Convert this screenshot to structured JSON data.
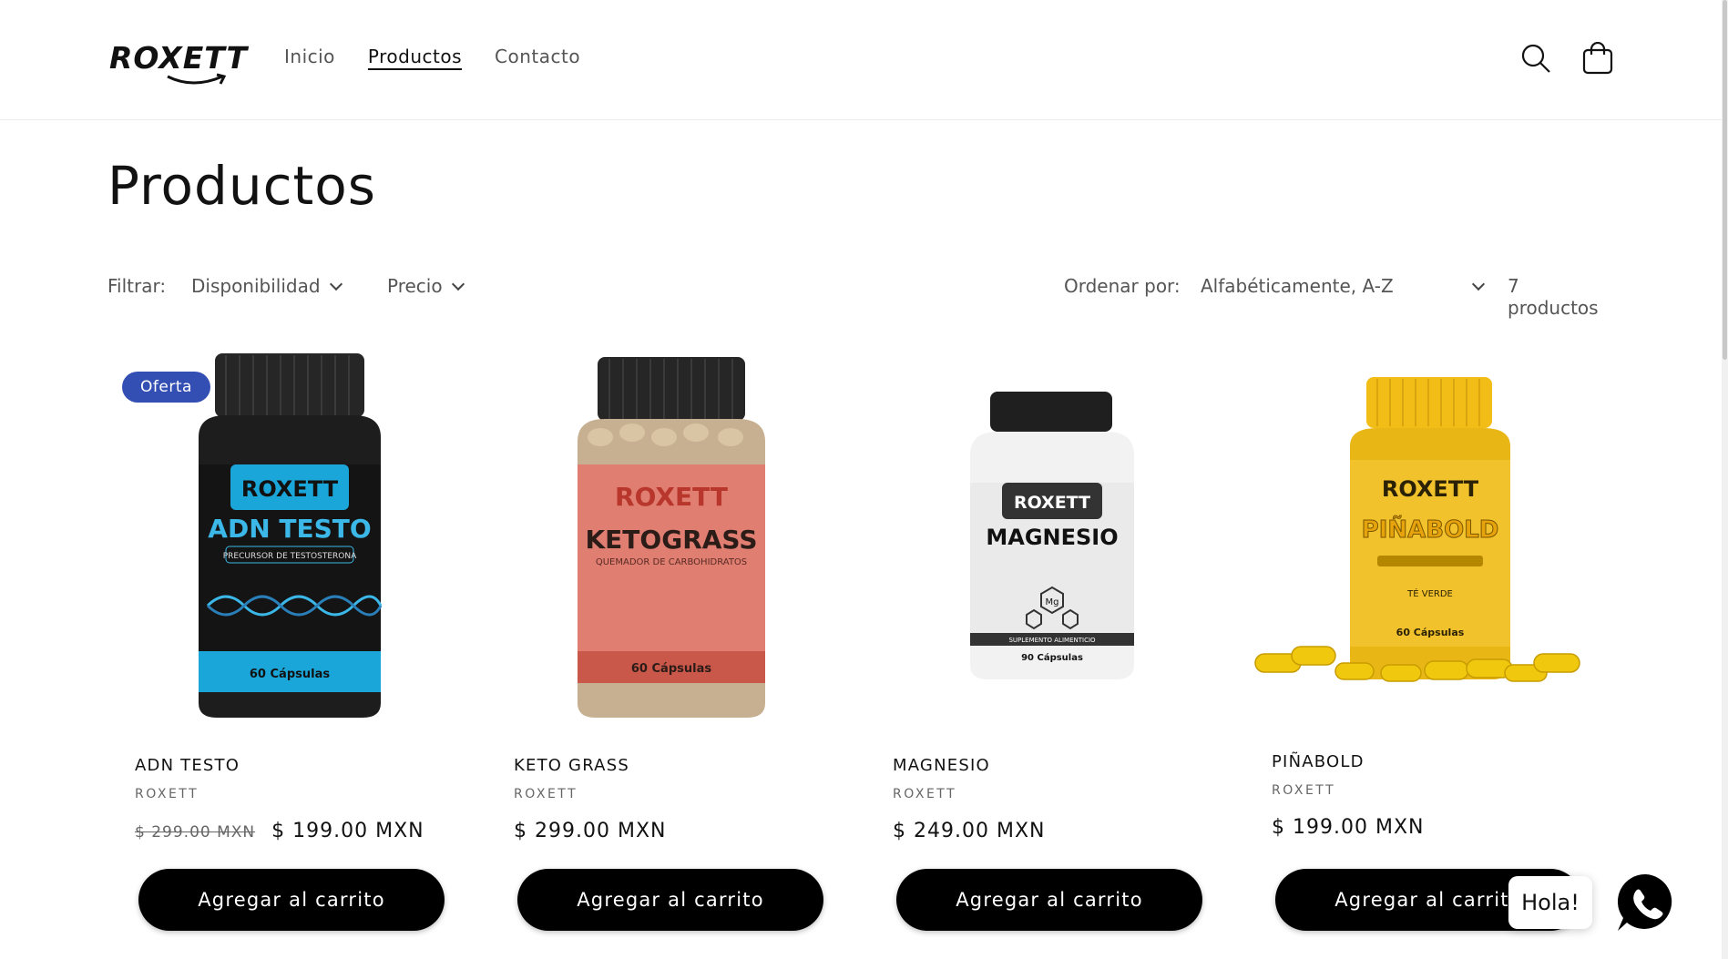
{
  "brand": {
    "logo_text": "ROXETT"
  },
  "nav": {
    "items": [
      "Inicio",
      "Productos",
      "Contacto"
    ],
    "active": "Productos"
  },
  "header": {
    "search_icon": "search-icon",
    "cart_icon": "bag-icon"
  },
  "page": {
    "title": "Productos"
  },
  "filters": {
    "label": "Filtrar:",
    "availability": "Disponibilidad",
    "price": "Precio",
    "sort_label": "Ordenar por:",
    "sort_value": "Alfabéticamente, A-Z",
    "count": "7 productos"
  },
  "products": [
    {
      "title": "ADN TESTO",
      "vendor": "ROXETT",
      "badge": "Oferta",
      "price_old": "$ 299.00 MXN",
      "price": "$ 199.00 MXN",
      "button": "Agregar al carrito",
      "label_name": "ADN TESTO",
      "label_sub": "PRECURSOR DE TESTOSTERONA",
      "label_caps": "60 Cápsulas",
      "label_brand": "ROXETT"
    },
    {
      "title": "KETO GRASS",
      "vendor": "ROXETT",
      "price": "$ 299.00 MXN",
      "button": "Agregar al carrito",
      "label_name": "KETOGRASS",
      "label_sub": "QUEMADOR DE CARBOHIDRATOS",
      "label_caps": "60 Cápsulas",
      "label_brand": "ROXETT"
    },
    {
      "title": "MAGNESIO",
      "vendor": "ROXETT",
      "price": "$ 249.00 MXN",
      "button": "Agregar al carrito",
      "label_name": "MAGNESIO",
      "label_sub": "SUPLEMENTO ALIMENTICIO",
      "label_caps": "90 Cápsulas",
      "label_brand": "ROXETT"
    },
    {
      "title": "PIÑABOLD",
      "vendor": "ROXETT",
      "price": "$ 199.00 MXN",
      "button": "Agregar al carrito",
      "label_name": "PIÑABOLD",
      "label_sub": "TÉ VERDE",
      "label_caps": "60 Cápsulas",
      "label_brand": "ROXETT"
    }
  ],
  "chat": {
    "greeting": "Hola!",
    "icon": "whatsapp-icon"
  },
  "colors": {
    "badge": "#334fb4",
    "button": "#000000",
    "testo_label": "#1ba6d9",
    "keto_label": "#e07e72",
    "pina_label": "#f2c22c"
  }
}
